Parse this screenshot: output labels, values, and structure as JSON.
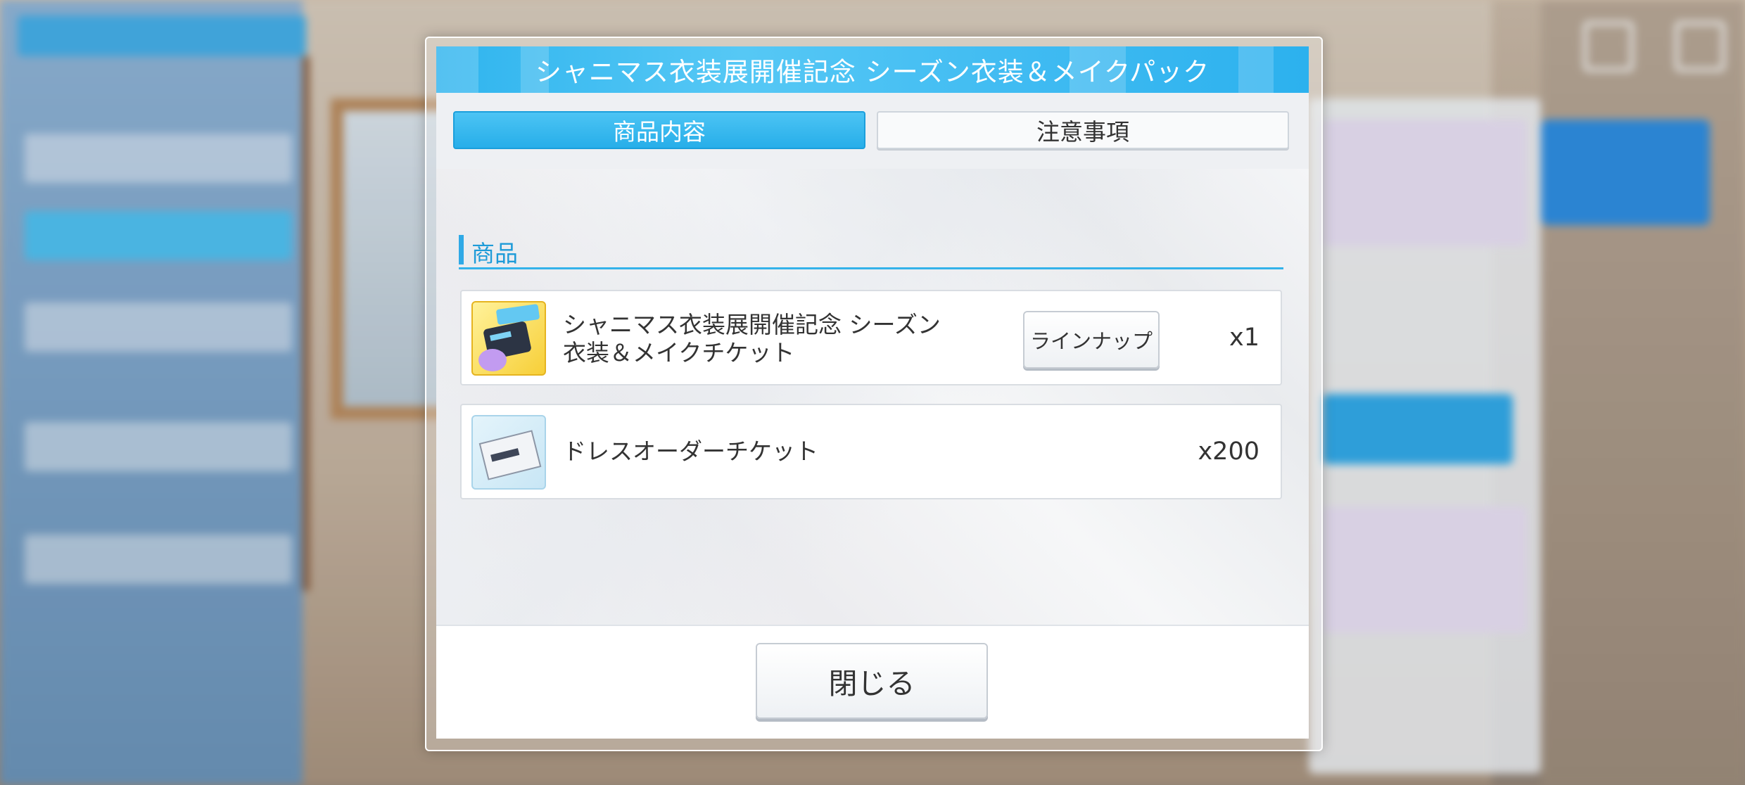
{
  "dialog": {
    "title": "シャニマス衣装展開催記念 シーズン衣装＆メイクパック",
    "tabs": [
      {
        "label": "商品内容",
        "active": true
      },
      {
        "label": "注意事項",
        "active": false
      }
    ],
    "section_label": "商品",
    "items": [
      {
        "name": "シャニマス衣装展開催記念 シーズン衣装＆メイクチケット",
        "button_label": "ラインナップ",
        "quantity": "x1",
        "icon": "season-ticket-icon"
      },
      {
        "name": "ドレスオーダーチケット",
        "quantity": "x200",
        "icon": "dress-order-ticket-icon"
      }
    ],
    "close_label": "閉じる"
  },
  "colors": {
    "accent": "#2fb4ee",
    "tab_active": "#27aee9",
    "section_line": "#33b2ea"
  }
}
